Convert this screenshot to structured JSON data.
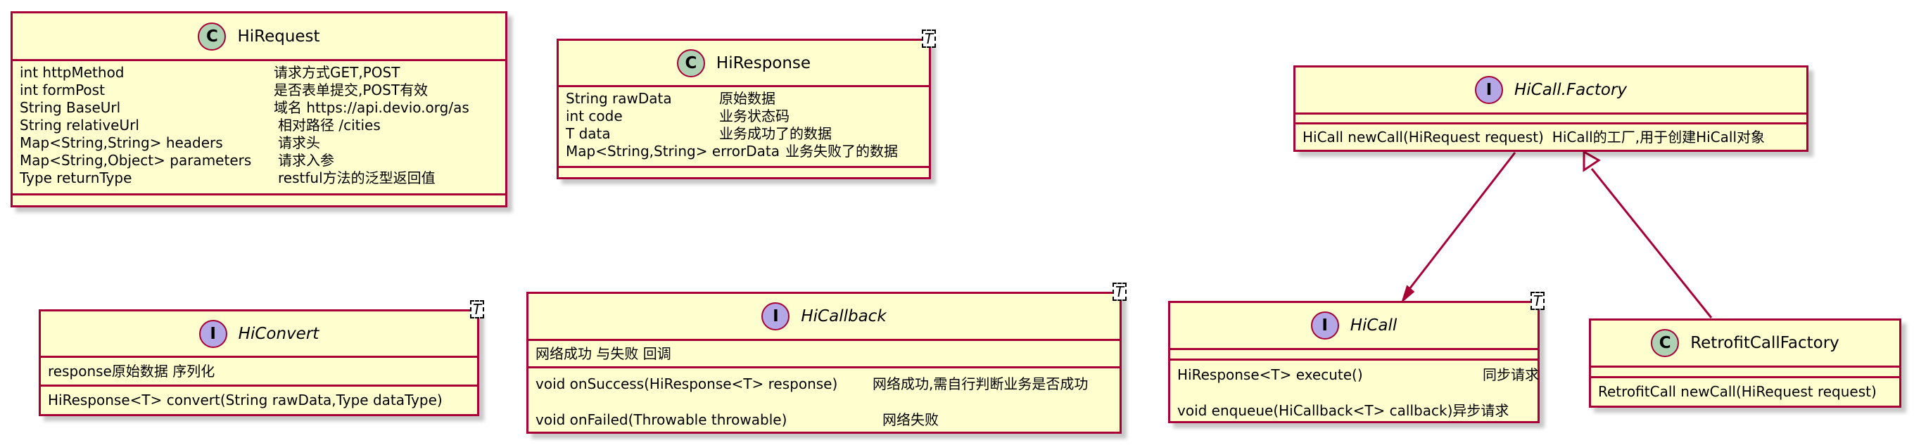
{
  "colors": {
    "border": "#A80036",
    "fill": "#FEFECE",
    "class_badge": "#ADD1B2",
    "interface_badge": "#B4A7E5"
  },
  "classes": {
    "hirequest": {
      "name": "HiRequest",
      "badge": "C",
      "generic": "",
      "sections": [
        [
          {
            "a": "int httpMethod",
            "b": "请求方式GET,POST"
          },
          {
            "a": "int formPost",
            "b": "是否表单提交,POST有效"
          },
          {
            "a": "String BaseUrl",
            "b": "域名    https://api.devio.org/as"
          },
          {
            "a": "String relativeUrl",
            "b": "相对路径   /cities"
          },
          {
            "a": "Map<String,String>  headers",
            "b": "请求头"
          },
          {
            "a": "Map<String,Object>  parameters",
            "b": "请求入参"
          },
          {
            "a": "Type returnType",
            "b": "restful方法的泛型返回值"
          }
        ],
        []
      ]
    },
    "hiresponse": {
      "name": "HiResponse",
      "badge": "C",
      "generic": "T",
      "sections": [
        [
          {
            "a": "String rawData",
            "b": "原始数据"
          },
          {
            "a": "int code",
            "b": "业务状态码"
          },
          {
            "a": "T data",
            "b": "业务成功了的数据"
          },
          {
            "a": "Map<String,String>  errorData",
            "b": "业务失败了的数据"
          }
        ],
        []
      ]
    },
    "hicall_factory": {
      "name": "HiCall.Factory",
      "badge": "I",
      "generic": "",
      "sections": [
        [],
        [
          {
            "a": "HiCall newCall(HiRequest request)",
            "b": "HiCall的工厂,用于创建HiCall对象"
          }
        ]
      ]
    },
    "hiconvert": {
      "name": "HiConvert",
      "badge": "I",
      "generic": "T",
      "sections": [
        [
          {
            "a": "response原始数据 序列化",
            "b": ""
          }
        ],
        [
          {
            "a": "HiResponse<T> convert(String rawData,Type dataType)",
            "b": ""
          }
        ]
      ]
    },
    "hicallback": {
      "name": "HiCallback",
      "badge": "I",
      "generic": "T",
      "sections": [
        [
          {
            "a": "网络成功 与失败 回调",
            "b": ""
          }
        ],
        [
          {
            "a": "void onSuccess(HiResponse<T> response)",
            "b": "网络成功,需自行判断业务是否成功"
          },
          {
            "a": "void onFailed(Throwable throwable)",
            "b": "网络失败"
          }
        ]
      ]
    },
    "hicall": {
      "name": "HiCall",
      "badge": "I",
      "generic": "T",
      "sections": [
        [],
        [
          {
            "a": "HiResponse<T> execute()",
            "b": "同步请求"
          },
          {
            "a": "void enqueue(HiCallback<T> callback)",
            "b": "异步请求"
          }
        ]
      ]
    },
    "retrofit_call_factory": {
      "name": "RetrofitCallFactory",
      "badge": "C",
      "generic": "",
      "sections": [
        [],
        [
          {
            "a": "RetrofitCall newCall(HiRequest request)",
            "b": ""
          }
        ]
      ]
    }
  },
  "relations": [
    {
      "from": "HiCall.Factory",
      "to": "HiCall",
      "type": "association"
    },
    {
      "from": "RetrofitCallFactory",
      "to": "HiCall.Factory",
      "type": "implementation"
    }
  ]
}
